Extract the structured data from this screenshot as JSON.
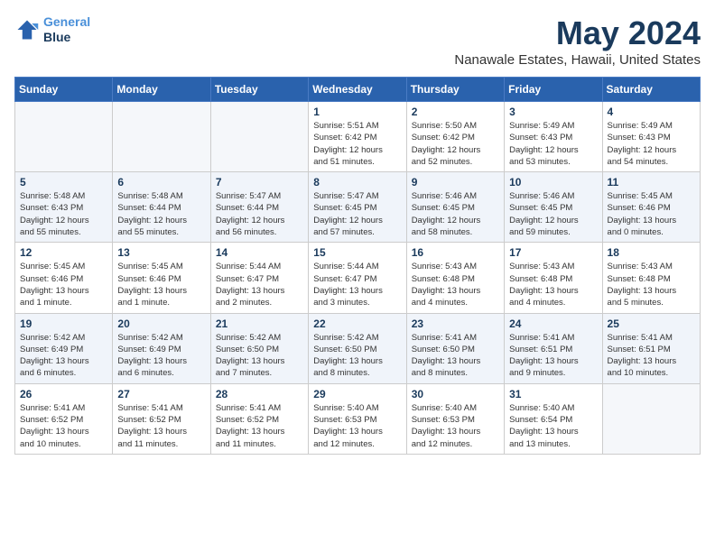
{
  "logo": {
    "line1": "General",
    "line2": "Blue"
  },
  "title": "May 2024",
  "location": "Nanawale Estates, Hawaii, United States",
  "weekdays": [
    "Sunday",
    "Monday",
    "Tuesday",
    "Wednesday",
    "Thursday",
    "Friday",
    "Saturday"
  ],
  "weeks": [
    [
      {
        "day": "",
        "info": ""
      },
      {
        "day": "",
        "info": ""
      },
      {
        "day": "",
        "info": ""
      },
      {
        "day": "1",
        "info": "Sunrise: 5:51 AM\nSunset: 6:42 PM\nDaylight: 12 hours\nand 51 minutes."
      },
      {
        "day": "2",
        "info": "Sunrise: 5:50 AM\nSunset: 6:42 PM\nDaylight: 12 hours\nand 52 minutes."
      },
      {
        "day": "3",
        "info": "Sunrise: 5:49 AM\nSunset: 6:43 PM\nDaylight: 12 hours\nand 53 minutes."
      },
      {
        "day": "4",
        "info": "Sunrise: 5:49 AM\nSunset: 6:43 PM\nDaylight: 12 hours\nand 54 minutes."
      }
    ],
    [
      {
        "day": "5",
        "info": "Sunrise: 5:48 AM\nSunset: 6:43 PM\nDaylight: 12 hours\nand 55 minutes."
      },
      {
        "day": "6",
        "info": "Sunrise: 5:48 AM\nSunset: 6:44 PM\nDaylight: 12 hours\nand 55 minutes."
      },
      {
        "day": "7",
        "info": "Sunrise: 5:47 AM\nSunset: 6:44 PM\nDaylight: 12 hours\nand 56 minutes."
      },
      {
        "day": "8",
        "info": "Sunrise: 5:47 AM\nSunset: 6:45 PM\nDaylight: 12 hours\nand 57 minutes."
      },
      {
        "day": "9",
        "info": "Sunrise: 5:46 AM\nSunset: 6:45 PM\nDaylight: 12 hours\nand 58 minutes."
      },
      {
        "day": "10",
        "info": "Sunrise: 5:46 AM\nSunset: 6:45 PM\nDaylight: 12 hours\nand 59 minutes."
      },
      {
        "day": "11",
        "info": "Sunrise: 5:45 AM\nSunset: 6:46 PM\nDaylight: 13 hours\nand 0 minutes."
      }
    ],
    [
      {
        "day": "12",
        "info": "Sunrise: 5:45 AM\nSunset: 6:46 PM\nDaylight: 13 hours\nand 1 minute."
      },
      {
        "day": "13",
        "info": "Sunrise: 5:45 AM\nSunset: 6:46 PM\nDaylight: 13 hours\nand 1 minute."
      },
      {
        "day": "14",
        "info": "Sunrise: 5:44 AM\nSunset: 6:47 PM\nDaylight: 13 hours\nand 2 minutes."
      },
      {
        "day": "15",
        "info": "Sunrise: 5:44 AM\nSunset: 6:47 PM\nDaylight: 13 hours\nand 3 minutes."
      },
      {
        "day": "16",
        "info": "Sunrise: 5:43 AM\nSunset: 6:48 PM\nDaylight: 13 hours\nand 4 minutes."
      },
      {
        "day": "17",
        "info": "Sunrise: 5:43 AM\nSunset: 6:48 PM\nDaylight: 13 hours\nand 4 minutes."
      },
      {
        "day": "18",
        "info": "Sunrise: 5:43 AM\nSunset: 6:48 PM\nDaylight: 13 hours\nand 5 minutes."
      }
    ],
    [
      {
        "day": "19",
        "info": "Sunrise: 5:42 AM\nSunset: 6:49 PM\nDaylight: 13 hours\nand 6 minutes."
      },
      {
        "day": "20",
        "info": "Sunrise: 5:42 AM\nSunset: 6:49 PM\nDaylight: 13 hours\nand 6 minutes."
      },
      {
        "day": "21",
        "info": "Sunrise: 5:42 AM\nSunset: 6:50 PM\nDaylight: 13 hours\nand 7 minutes."
      },
      {
        "day": "22",
        "info": "Sunrise: 5:42 AM\nSunset: 6:50 PM\nDaylight: 13 hours\nand 8 minutes."
      },
      {
        "day": "23",
        "info": "Sunrise: 5:41 AM\nSunset: 6:50 PM\nDaylight: 13 hours\nand 8 minutes."
      },
      {
        "day": "24",
        "info": "Sunrise: 5:41 AM\nSunset: 6:51 PM\nDaylight: 13 hours\nand 9 minutes."
      },
      {
        "day": "25",
        "info": "Sunrise: 5:41 AM\nSunset: 6:51 PM\nDaylight: 13 hours\nand 10 minutes."
      }
    ],
    [
      {
        "day": "26",
        "info": "Sunrise: 5:41 AM\nSunset: 6:52 PM\nDaylight: 13 hours\nand 10 minutes."
      },
      {
        "day": "27",
        "info": "Sunrise: 5:41 AM\nSunset: 6:52 PM\nDaylight: 13 hours\nand 11 minutes."
      },
      {
        "day": "28",
        "info": "Sunrise: 5:41 AM\nSunset: 6:52 PM\nDaylight: 13 hours\nand 11 minutes."
      },
      {
        "day": "29",
        "info": "Sunrise: 5:40 AM\nSunset: 6:53 PM\nDaylight: 13 hours\nand 12 minutes."
      },
      {
        "day": "30",
        "info": "Sunrise: 5:40 AM\nSunset: 6:53 PM\nDaylight: 13 hours\nand 12 minutes."
      },
      {
        "day": "31",
        "info": "Sunrise: 5:40 AM\nSunset: 6:54 PM\nDaylight: 13 hours\nand 13 minutes."
      },
      {
        "day": "",
        "info": ""
      }
    ]
  ]
}
